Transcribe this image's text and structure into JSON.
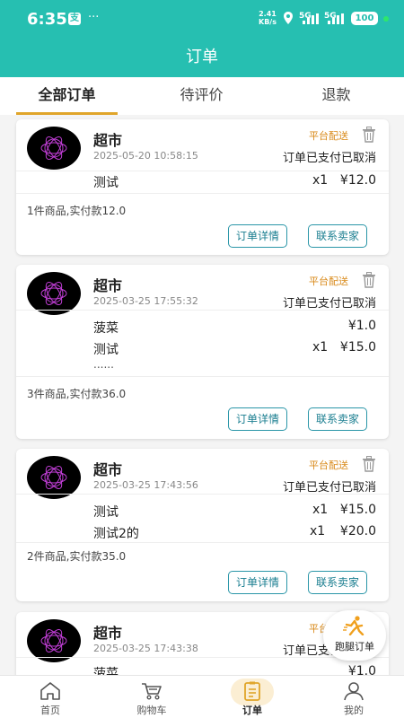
{
  "status_bar": {
    "time": "6:35",
    "app_icon": "支",
    "dots": "···",
    "speed_value": "2.41",
    "speed_unit": "KB/s",
    "signal1": "5G",
    "signal2": "5G",
    "battery": "100"
  },
  "header": {
    "title": "订单"
  },
  "tabs": [
    {
      "label": "全部订单",
      "active": true
    },
    {
      "label": "待评价",
      "active": false
    },
    {
      "label": "退款",
      "active": false
    }
  ],
  "orders": [
    {
      "store": "超市",
      "time": "2025-05-20 10:58:15",
      "delivery": "平台配送",
      "status": "订单已支付已取消",
      "items": [
        {
          "name": "测试",
          "qty": "x1",
          "price": "¥12.0"
        }
      ],
      "summary": "1件商品,实付款12.0",
      "detail_btn": "订单详情",
      "contact_btn": "联系卖家"
    },
    {
      "store": "超市",
      "time": "2025-03-25 17:55:32",
      "delivery": "平台配送",
      "status": "订单已支付已取消",
      "items": [
        {
          "name": "菠菜",
          "qty": "",
          "price": "¥1.0"
        },
        {
          "name": "测试",
          "qty": "x1",
          "price": "¥15.0"
        }
      ],
      "more": "......",
      "summary": "3件商品,实付款36.0",
      "detail_btn": "订单详情",
      "contact_btn": "联系卖家"
    },
    {
      "store": "超市",
      "time": "2025-03-25 17:43:56",
      "delivery": "平台配送",
      "status": "订单已支付已取消",
      "items": [
        {
          "name": "测试",
          "qty": "x1",
          "price": "¥15.0"
        },
        {
          "name": "测试2的",
          "qty": "x1",
          "price": "¥20.0"
        }
      ],
      "summary": "2件商品,实付款35.0",
      "detail_btn": "订单详情",
      "contact_btn": "联系卖家"
    },
    {
      "store": "超市",
      "time": "2025-03-25 17:43:38",
      "delivery": "平台配送",
      "status": "订单已支付已取消",
      "items": [
        {
          "name": "菠菜",
          "qty": "",
          "price": "¥1.0"
        }
      ]
    }
  ],
  "fab": {
    "label": "跑腿订单",
    "icon": "running-man-icon"
  },
  "bottom_nav": [
    {
      "label": "首页",
      "icon": "home-icon"
    },
    {
      "label": "购物车",
      "icon": "cart-icon"
    },
    {
      "label": "订单",
      "icon": "order-list-icon",
      "active": true
    },
    {
      "label": "我的",
      "icon": "user-icon"
    }
  ],
  "colors": {
    "primary": "#26bfb1",
    "accent": "#e0a52a",
    "button_border": "#2a96a8",
    "delivery": "#d98a1a"
  }
}
